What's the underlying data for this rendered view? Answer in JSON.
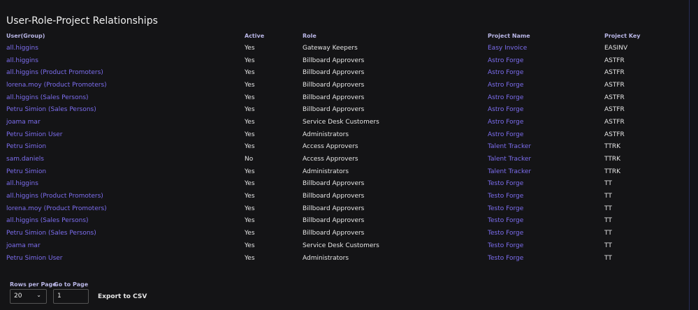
{
  "title": "User-Role-Project Relationships",
  "columns": [
    "User(Group)",
    "Active",
    "Role",
    "Project Name",
    "Project Key"
  ],
  "rows": [
    [
      "all.higgins",
      "Yes",
      "Gateway Keepers",
      "Easy Invoice",
      "EASINV"
    ],
    [
      "all.higgins",
      "Yes",
      "Billboard Approvers",
      "Astro Forge",
      "ASTFR"
    ],
    [
      "all.higgins (Product Promoters)",
      "Yes",
      "Billboard Approvers",
      "Astro Forge",
      "ASTFR"
    ],
    [
      "lorena.moy (Product Promoters)",
      "Yes",
      "Billboard Approvers",
      "Astro Forge",
      "ASTFR"
    ],
    [
      "all.higgins (Sales Persons)",
      "Yes",
      "Billboard Approvers",
      "Astro Forge",
      "ASTFR"
    ],
    [
      "Petru Simion (Sales Persons)",
      "Yes",
      "Billboard Approvers",
      "Astro Forge",
      "ASTFR"
    ],
    [
      "joama mar",
      "Yes",
      "Service Desk Customers",
      "Astro Forge",
      "ASTFR"
    ],
    [
      "Petru Simion User",
      "Yes",
      "Administrators",
      "Astro Forge",
      "ASTFR"
    ],
    [
      "Petru Simion",
      "Yes",
      "Access Approvers",
      "Talent Tracker",
      "TTRK"
    ],
    [
      "sam.daniels",
      "No",
      "Access Approvers",
      "Talent Tracker",
      "TTRK"
    ],
    [
      "Petru Simion",
      "Yes",
      "Administrators",
      "Talent Tracker",
      "TTRK"
    ],
    [
      "all.higgins",
      "Yes",
      "Billboard Approvers",
      "Testo Forge",
      "TT"
    ],
    [
      "all.higgins (Product Promoters)",
      "Yes",
      "Billboard Approvers",
      "Testo Forge",
      "TT"
    ],
    [
      "lorena.moy (Product Promoters)",
      "Yes",
      "Billboard Approvers",
      "Testo Forge",
      "TT"
    ],
    [
      "all.higgins (Sales Persons)",
      "Yes",
      "Billboard Approvers",
      "Testo Forge",
      "TT"
    ],
    [
      "Petru Simion (Sales Persons)",
      "Yes",
      "Billboard Approvers",
      "Testo Forge",
      "TT"
    ],
    [
      "joama mar",
      "Yes",
      "Service Desk Customers",
      "Testo Forge",
      "TT"
    ],
    [
      "Petru Simion User",
      "Yes",
      "Administrators",
      "Testo Forge",
      "TT"
    ]
  ],
  "footer": {
    "rows_per_page_label": "Rows per Page",
    "rows_per_page_value": "20",
    "go_to_page_label": "Go to Page",
    "go_to_page_value": "1",
    "export_label": "Export to CSV"
  }
}
